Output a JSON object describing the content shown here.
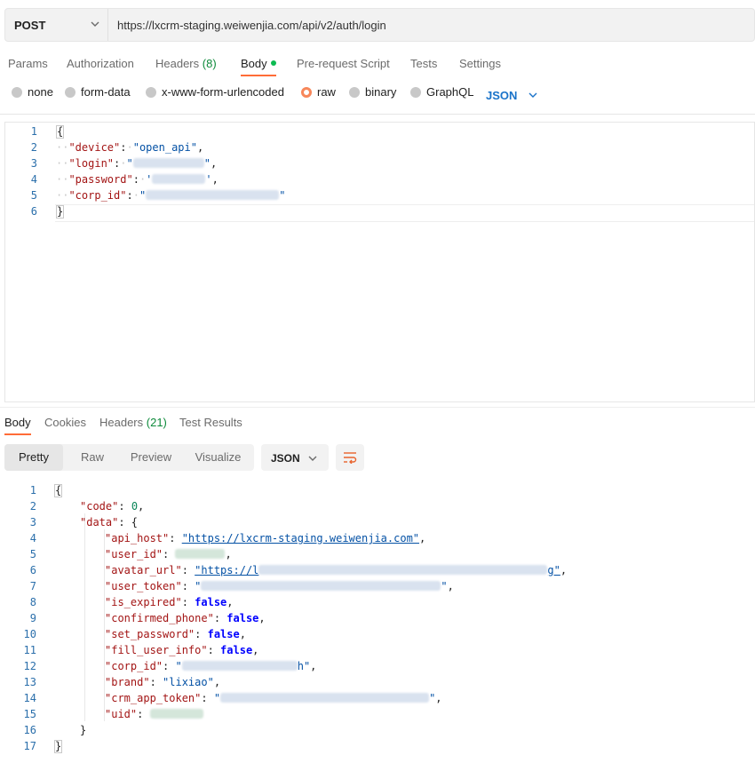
{
  "request": {
    "method": "POST",
    "url": "https://lxcrm-staging.weiwenjia.com/api/v2/auth/login"
  },
  "request_tabs": [
    {
      "label": "Params"
    },
    {
      "label": "Authorization"
    },
    {
      "label": "Headers",
      "count": "(8)"
    },
    {
      "label": "Body"
    },
    {
      "label": "Pre-request Script"
    },
    {
      "label": "Tests"
    },
    {
      "label": "Settings"
    }
  ],
  "body_types": [
    "none",
    "form-data",
    "x-www-form-urlencoded",
    "raw",
    "binary",
    "GraphQL"
  ],
  "body_format": "JSON",
  "request_body": {
    "line_numbers": [
      "1",
      "2",
      "3",
      "4",
      "5",
      "6"
    ],
    "open_brace": "{",
    "close_brace": "}",
    "lines": [
      {
        "key": "\"device\"",
        "value": "\"open_api\""
      },
      {
        "key": "\"login\"",
        "value": "\""
      },
      {
        "key": "\"password\"",
        "value": "'"
      },
      {
        "key": "\"corp_id\"",
        "value": "\""
      }
    ]
  },
  "response_tabs": [
    {
      "label": "Body"
    },
    {
      "label": "Cookies"
    },
    {
      "label": "Headers",
      "count": "(21)"
    },
    {
      "label": "Test Results"
    }
  ],
  "view_modes": [
    "Pretty",
    "Raw",
    "Preview",
    "Visualize"
  ],
  "response_format": "JSON",
  "response_body": {
    "line_numbers": [
      "1",
      "2",
      "3",
      "4",
      "5",
      "6",
      "7",
      "8",
      "9",
      "10",
      "11",
      "12",
      "13",
      "14",
      "15",
      "16",
      "17"
    ],
    "code_key": "\"code\"",
    "code_value": "0",
    "data_key": "\"data\"",
    "api_host_key": "\"api_host\"",
    "api_host_value": "\"https://lxcrm-staging.weiwenjia.com\"",
    "user_id_key": "\"user_id\"",
    "avatar_url_key": "\"avatar_url\"",
    "avatar_url_value": "\"https://l",
    "avatar_url_tail": "g\"",
    "user_token_key": "\"user_token\"",
    "is_expired_key": "\"is_expired\"",
    "is_expired_value": "false",
    "confirmed_phone_key": "\"confirmed_phone\"",
    "confirmed_phone_value": "false",
    "set_password_key": "\"set_password\"",
    "set_password_value": "false",
    "fill_user_info_key": "\"fill_user_info\"",
    "fill_user_info_value": "false",
    "corp_id_key": "\"corp_id\"",
    "corp_id_tail": "h\"",
    "brand_key": "\"brand\"",
    "brand_value": "\"lixiao\"",
    "crm_app_token_key": "\"crm_app_token\"",
    "uid_key": "\"uid\""
  }
}
